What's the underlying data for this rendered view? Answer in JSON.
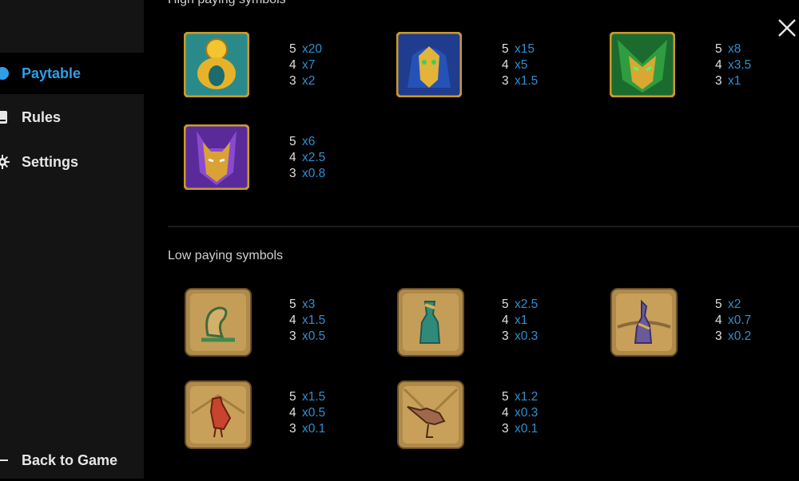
{
  "nav": {
    "items": [
      {
        "label": "Paytable",
        "icon": "circle-icon",
        "active": true
      },
      {
        "label": "Rules",
        "icon": "book-icon",
        "active": false
      },
      {
        "label": "Settings",
        "icon": "gear-icon",
        "active": false
      }
    ],
    "back_label": "Back to Game"
  },
  "colors": {
    "accent": "#2f9ee6",
    "multiplier": "#2f8fd0",
    "sidebar_bg": "#141414"
  },
  "high_section": {
    "title": "High paying symbols",
    "symbols": [
      {
        "icon": "golden-sun-scarab-icon",
        "pays": [
          {
            "count": "5",
            "mult": "x20"
          },
          {
            "count": "4",
            "mult": "x7"
          },
          {
            "count": "3",
            "mult": "x2"
          }
        ]
      },
      {
        "icon": "blue-gold-lion-icon",
        "pays": [
          {
            "count": "5",
            "mult": "x15"
          },
          {
            "count": "4",
            "mult": "x5"
          },
          {
            "count": "3",
            "mult": "x1.5"
          }
        ]
      },
      {
        "icon": "green-gold-mask-icon",
        "pays": [
          {
            "count": "5",
            "mult": "x8"
          },
          {
            "count": "4",
            "mult": "x3.5"
          },
          {
            "count": "3",
            "mult": "x1"
          }
        ]
      },
      {
        "icon": "purple-gold-jackal-icon",
        "pays": [
          {
            "count": "5",
            "mult": "x6"
          },
          {
            "count": "4",
            "mult": "x2.5"
          },
          {
            "count": "3",
            "mult": "x0.8"
          }
        ]
      }
    ]
  },
  "low_section": {
    "title": "Low paying symbols",
    "symbols": [
      {
        "icon": "cobra-hieroglyph-icon",
        "pays": [
          {
            "count": "5",
            "mult": "x3"
          },
          {
            "count": "4",
            "mult": "x1.5"
          },
          {
            "count": "3",
            "mult": "x0.5"
          }
        ]
      },
      {
        "icon": "cat-hieroglyph-icon",
        "pays": [
          {
            "count": "5",
            "mult": "x2.5"
          },
          {
            "count": "4",
            "mult": "x1"
          },
          {
            "count": "3",
            "mult": "x0.3"
          }
        ]
      },
      {
        "icon": "jackal-hieroglyph-icon",
        "pays": [
          {
            "count": "5",
            "mult": "x2"
          },
          {
            "count": "4",
            "mult": "x0.7"
          },
          {
            "count": "3",
            "mult": "x0.2"
          }
        ]
      },
      {
        "icon": "red-bird-hieroglyph-icon",
        "pays": [
          {
            "count": "5",
            "mult": "x1.5"
          },
          {
            "count": "4",
            "mult": "x0.5"
          },
          {
            "count": "3",
            "mult": "x0.1"
          }
        ]
      },
      {
        "icon": "ibis-hieroglyph-icon",
        "pays": [
          {
            "count": "5",
            "mult": "x1.2"
          },
          {
            "count": "4",
            "mult": "x0.3"
          },
          {
            "count": "3",
            "mult": "x0.1"
          }
        ]
      }
    ]
  }
}
